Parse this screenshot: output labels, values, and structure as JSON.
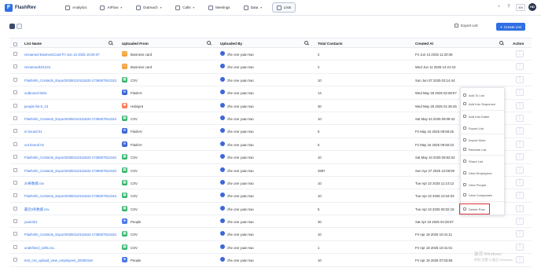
{
  "app": {
    "logo_text": "FlashRev"
  },
  "nav": [
    {
      "label": "Analytics",
      "active": false,
      "caret": false
    },
    {
      "label": "AIFlow",
      "active": false,
      "caret": true
    },
    {
      "label": "Outreach",
      "active": false,
      "caret": true
    },
    {
      "label": "Calls",
      "active": false,
      "caret": true
    },
    {
      "label": "Meetings",
      "active": false,
      "caret": false
    },
    {
      "label": "Data",
      "active": false,
      "caret": true
    },
    {
      "label": "Lists",
      "active": true,
      "caret": false
    }
  ],
  "topright": {
    "lang": "EN",
    "avatar": "HD"
  },
  "toolbar": {
    "export_label": "Export List",
    "create_label": "Create List"
  },
  "table": {
    "headers": {
      "name": "List Name",
      "from": "Uploaded From",
      "by": "Uploaded By",
      "total": "Total Contacts",
      "created": "Created At",
      "action": "Action"
    },
    "rows": [
      {
        "name": "Unnamed BusinessCard Fri Jun 13 2025 19:20:37",
        "from": "Business card",
        "src": "bc",
        "by": "zhe one yuan two",
        "total": "2",
        "created": "Fri Jun 13 2025 11:20:38"
      },
      {
        "name": "Unnamed101223",
        "from": "Business card",
        "src": "bc",
        "by": "zhe one yuan two",
        "total": "2",
        "created": "Wed Jun 11 2025 12:21:43"
      },
      {
        "name": "FlashInfo_Contacts_Export20250110111632-1736507912153...",
        "from": "CSV",
        "src": "csv",
        "by": "zhe one yuan two",
        "total": "10",
        "created": "Sun Jun 07 2025 03:14:44"
      },
      {
        "name": "outbound 0521",
        "from": "FlashAI",
        "src": "ai",
        "by": "zhe one yuan two",
        "total": "14",
        "created": "Wed May 28 2025 02:08:07"
      },
      {
        "name": "people list 9_13",
        "from": "Hubspot",
        "src": "hub",
        "by": "zhe one yuan two",
        "total": "30",
        "created": "Wed May 28 2025 01:36:45"
      },
      {
        "name": "FlashInfo_Contacts_Export20250110111632-1736507912153...",
        "from": "CSV",
        "src": "csv",
        "by": "zhe one yuan two",
        "total": "10",
        "created": "Sat May 24 2025 09:08:42"
      },
      {
        "name": "in bound 01",
        "from": "FlashAI",
        "src": "ai",
        "by": "zhe one yuan two",
        "total": "5",
        "created": "Fri May 16 2025 09:58:45"
      },
      {
        "name": "out bound 01",
        "from": "FlashAI",
        "src": "ai",
        "by": "zhe one yuan two",
        "total": "5",
        "created": "Fri May 16 2025 09:58:43"
      },
      {
        "name": "FlashInfo_Contacts_Export20250110111632-1736507912153...",
        "from": "CSV",
        "src": "csv",
        "by": "zhe one yuan two",
        "total": "10",
        "created": "Sat May 10 2025 09:52:04"
      },
      {
        "name": "FlashInfo_Contacts_Export20250110111632-1736507912153...",
        "from": "CSV",
        "src": "csv",
        "by": "zhe one yuan two",
        "total": "4987",
        "created": "Sun Apr 27 2025 12:08:09"
      },
      {
        "name": "20車数據.csv",
        "from": "CSV",
        "src": "csv",
        "by": "zhe one yuan two",
        "total": "10",
        "created": "Tue Apr 22 2025 11:14:12"
      },
      {
        "name": "FlashInfo_Contacts_Export20250110111632-1736507912153...",
        "from": "CSV",
        "src": "csv",
        "by": "zhe one yuan two",
        "total": "10",
        "created": "Tue Apr 22 2025 10:44:03"
      },
      {
        "name": "最近5条数據.csv",
        "from": "CSV",
        "src": "csv",
        "by": "zhe one yuan two",
        "total": "5",
        "created": "Tue Apr 22 2025 08:32:19"
      },
      {
        "name": "yuan321",
        "from": "People",
        "src": "people",
        "by": "zhe one yuan two",
        "total": "30",
        "created": "Sat Apr 19 2025 04:28:07"
      },
      {
        "name": "FlashInfo_Contacts_Export20250110111632-1736507912153...",
        "from": "CSV",
        "src": "csv",
        "by": "zhe one yuan two",
        "total": "10",
        "created": "Fri Apr 18 2025 10:41:11"
      },
      {
        "name": "undefined_1205.csv",
        "from": "CSV",
        "src": "csv",
        "by": "zhe one yuan two",
        "total": "1",
        "created": "Fri Apr 18 2025 10:41:01"
      },
      {
        "name": "test_csv_upload_view_employees_20250418",
        "from": "People",
        "src": "people",
        "by": "zhe one yuan two",
        "total": "10",
        "created": "Fri Apr 18 2025 07:03:55"
      }
    ]
  },
  "context_menu": {
    "items": [
      "Add To List",
      "Add Into Sequence",
      "Add Into Dialer",
      "Export List",
      "Import More",
      "Rename List",
      "Share List",
      "View Employees",
      "View People",
      "View Companies",
      "Delete Row"
    ]
  },
  "watermark": {
    "line1": "激活 Windows",
    "line2": "转到\"设置\"以激活 Windows。"
  },
  "colors": {
    "accent": "#2f6fe4",
    "highlight": "#d9363e",
    "csv": "#2fb36a",
    "bc": "#f2a23a",
    "hub": "#ff7a59",
    "ai": "#3c67d6",
    "people": "#4c7be8"
  }
}
